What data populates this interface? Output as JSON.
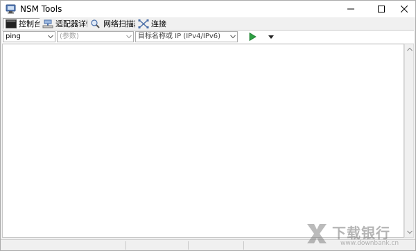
{
  "window": {
    "title": "NSM Tools"
  },
  "tabs": [
    {
      "label": "控制台",
      "icon": "console-icon",
      "active": true
    },
    {
      "label": "适配器详情",
      "icon": "network-adapter-icon",
      "active": false
    },
    {
      "label": "网络扫描器",
      "icon": "scanner-icon",
      "active": false
    },
    {
      "label": "连接",
      "icon": "connection-icon",
      "active": false
    }
  ],
  "toolbar": {
    "command_value": "ping",
    "param_placeholder": "(参数)",
    "target_placeholder": "目标名称或 IP (IPv4/IPv6)",
    "run_icon": "play-icon",
    "menu_icon": "dropdown-arrow-icon"
  },
  "watermark": {
    "title": "下载银行",
    "url": "www.downbank.cn"
  },
  "colors": {
    "run_green": "#2ea043",
    "window_bg": "#f0f0f0",
    "output_bg": "#ffffff"
  }
}
